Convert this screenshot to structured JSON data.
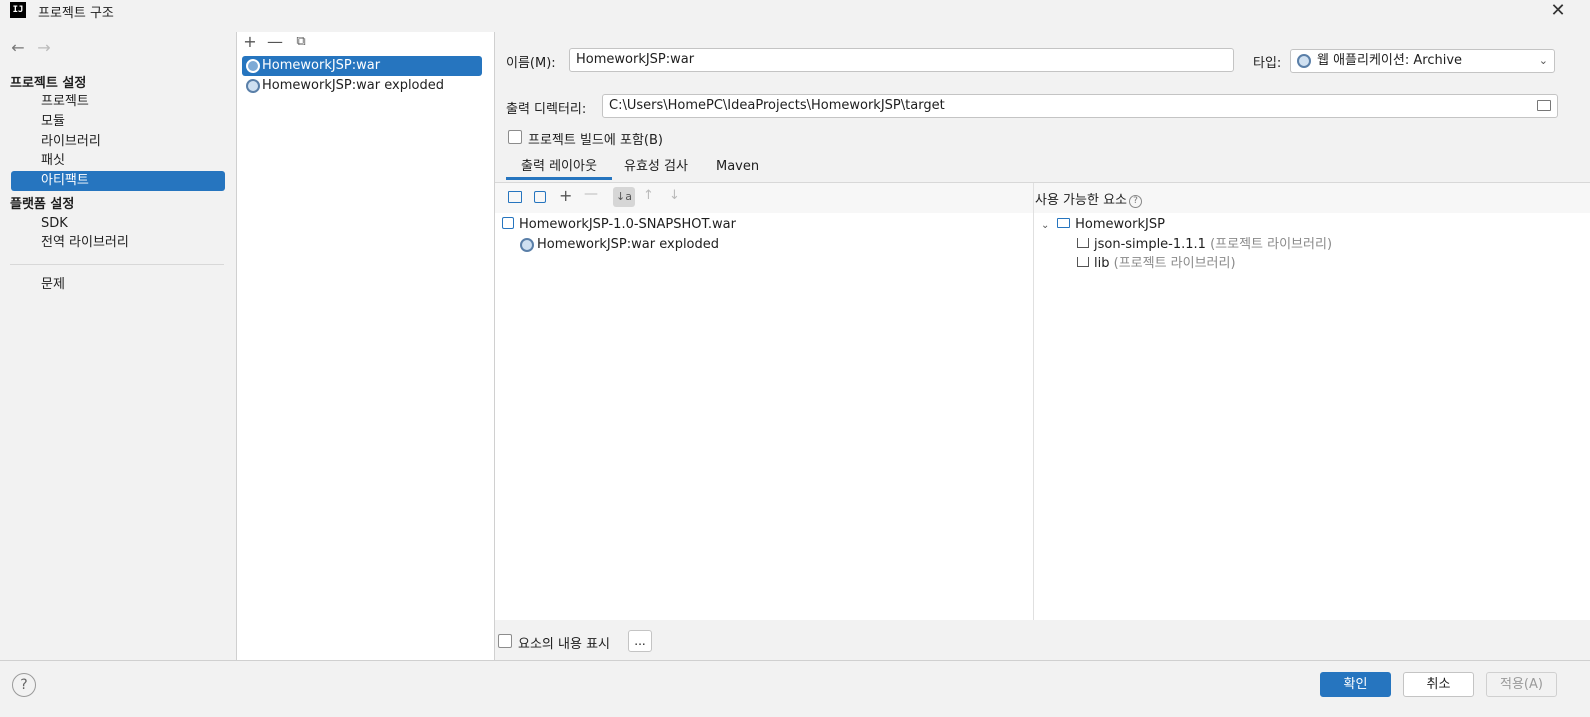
{
  "window": {
    "logo_text": "IJ",
    "title": "프로젝트 구조",
    "close_glyph": "✕"
  },
  "nav": {
    "back_glyph": "←",
    "forward_glyph": "→",
    "section1_title": "프로젝트 설정",
    "section1_items": [
      "프로젝트",
      "모듈",
      "라이브러리",
      "패싯",
      "아티팩트"
    ],
    "section2_title": "플랫폼 설정",
    "section2_items": [
      "SDK",
      "전역 라이브러리"
    ],
    "problems": "문제",
    "selected": "아티팩트"
  },
  "artifacts": {
    "toolbar": [
      "+",
      "—",
      "⧉"
    ],
    "items": [
      "HomeworkJSP:war",
      "HomeworkJSP:war exploded"
    ],
    "selected_index": 0
  },
  "form": {
    "name_label": "이름(M):",
    "name_value": "HomeworkJSP:war",
    "type_label": "타입:",
    "type_value": "웹 애플리케이션: Archive",
    "output_label": "출력 디렉터리:",
    "output_value": "C:\\Users\\HomePC\\IdeaProjects\\HomeworkJSP\\target",
    "include_build_label": "프로젝트 빌드에 포함(B)",
    "include_build_checked": false
  },
  "tabs": {
    "items": [
      "출력 레이아웃",
      "유효성 검사",
      "Maven"
    ],
    "active_index": 0
  },
  "layout": {
    "toolbar_icons": [
      "new-folder-icon",
      "archive-icon",
      "add-icon",
      "remove-icon",
      "sort-icon",
      "move-up-icon",
      "move-down-icon"
    ],
    "tree": [
      {
        "label": "HomeworkJSP-1.0-SNAPSHOT.war",
        "icon": "war-icon"
      },
      {
        "label": "HomeworkJSP:war exploded",
        "icon": "gear-icon"
      }
    ]
  },
  "available": {
    "header": "사용 가능한 요소",
    "help_glyph": "?",
    "root": "HomeworkJSP",
    "children": [
      {
        "name": "json-simple-1.1.1",
        "suffix": "(프로젝트 라이브러리)"
      },
      {
        "name": "lib",
        "suffix": "(프로젝트 라이브러리)"
      }
    ]
  },
  "bottom": {
    "show_content_label": "요소의 내용 표시",
    "dots_label": "..."
  },
  "footer": {
    "help_glyph": "?",
    "ok": "확인",
    "cancel": "취소",
    "apply": "적용(A)"
  },
  "colors": {
    "accent": "#2675bf",
    "panel_bg": "#f2f2f2",
    "content_bg": "#ffffff"
  }
}
